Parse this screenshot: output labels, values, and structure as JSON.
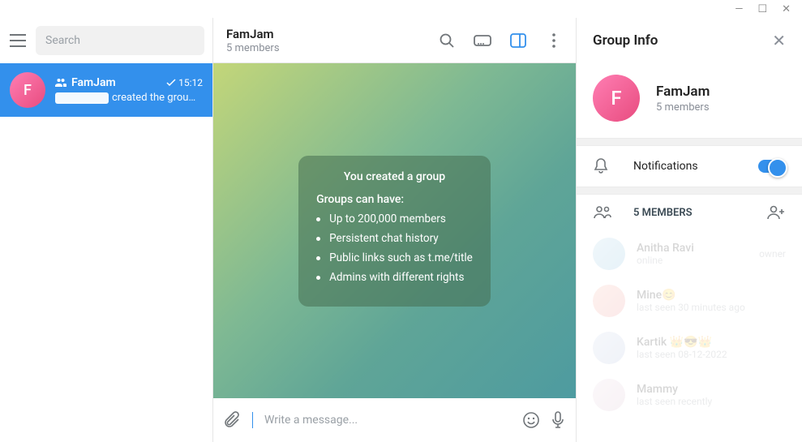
{
  "window": {
    "minimize": "—",
    "maximize": "☐",
    "close": "✕"
  },
  "sidebar": {
    "search_placeholder": "Search",
    "chat": {
      "avatar_letter": "F",
      "title": "FamJam",
      "time": "15:12",
      "preview_suffix": "created the grou…"
    }
  },
  "chat": {
    "title": "FamJam",
    "subtitle": "5 members",
    "bubble": {
      "created": "You created a group",
      "sub": "Groups can have:",
      "items": [
        "Up to 200,000 members",
        "Persistent chat history",
        "Public links such as t.me/title",
        "Admins with different rights"
      ]
    },
    "composer_placeholder": "Write a message..."
  },
  "panel": {
    "title": "Group Info",
    "group_name": "FamJam",
    "group_sub": "5 members",
    "avatar_letter": "F",
    "notifications_label": "Notifications",
    "members_label": "5 MEMBERS",
    "members": [
      {
        "name": "Anitha Ravi",
        "status": "online",
        "role": "owner",
        "avatar_bg": "linear-gradient(135deg,#a8d0e6,#7ab8d8)"
      },
      {
        "name": "Mine😊",
        "status": "last seen 30 minutes ago",
        "role": "",
        "avatar_bg": "linear-gradient(135deg,#f7b2a0,#e88a8a)"
      },
      {
        "name": "Kartik 👑😎👑",
        "status": "last seen 08-12-2022",
        "role": "",
        "avatar_bg": "linear-gradient(135deg,#c9d4e8,#a8b8d8)"
      },
      {
        "name": "Mammy",
        "status": "last seen recently",
        "role": "",
        "avatar_bg": "linear-gradient(135deg,#e8d4e0,#d4b8c8)"
      }
    ]
  }
}
